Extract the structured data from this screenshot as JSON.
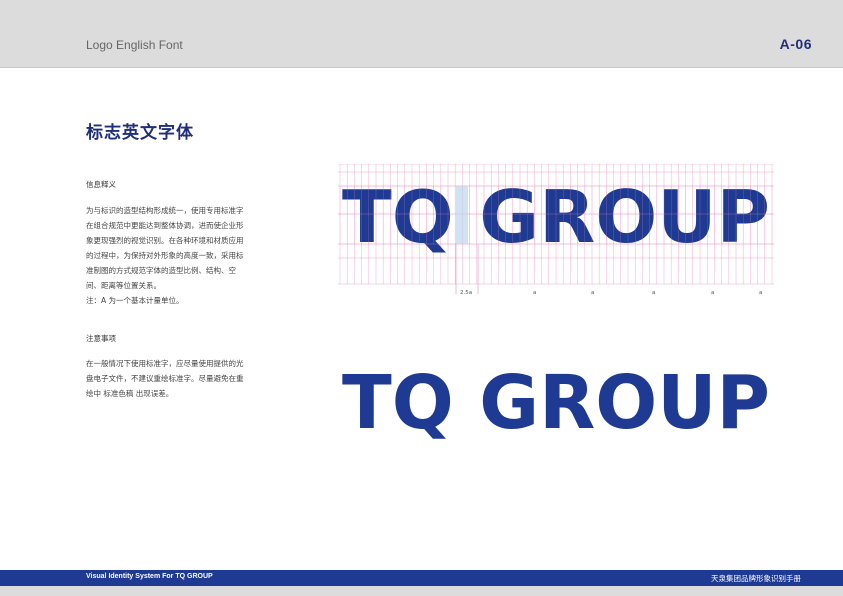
{
  "header": {
    "section_en": "Logo English Font",
    "page_code": "A-06"
  },
  "title": "标志英文字体",
  "info": {
    "heading": "信息释义",
    "lines": [
      "为与标识的造型结构形成统一，使用专用标准字",
      "在组合规范中更能达到整体协调，进而使企业形",
      "象更现强烈的视觉识别。在各种环境和材质应用",
      "的过程中，为保持对外形象的高度一致，采用标",
      "准制图的方式规范字体的造型比例、结构、空",
      "间、距离等位置关系。",
      "注：A 为一个基本计量单位。"
    ]
  },
  "notes": {
    "heading": "注意事项",
    "lines": [
      "在一般情况下使用标准字，应尽量使用提供的光",
      "盘电子文件，不建议重绘标准字。尽量避免在重",
      "绘中 标准色稿 出现误差。"
    ]
  },
  "logo": {
    "text": "TQ GROUP",
    "color": "#1f3a93"
  },
  "diagram": {
    "grid_color": "#e88fc0",
    "labels": [
      "2.5a",
      "a",
      "a",
      "a",
      "a",
      "a"
    ]
  },
  "footer": {
    "left": "Visual Identity System For TQ GROUP",
    "right": "天泉集团品牌形象识别手册"
  }
}
